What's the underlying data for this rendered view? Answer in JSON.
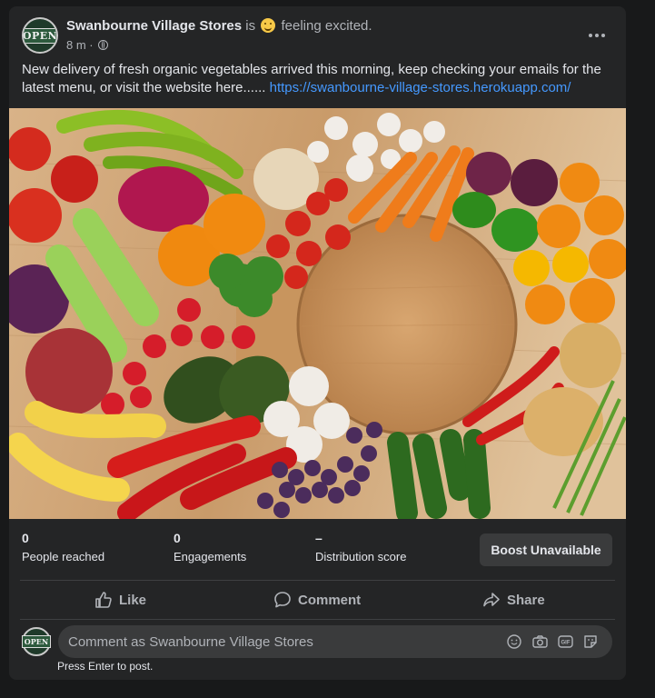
{
  "post": {
    "page_name": "Swanbourne Village Stores",
    "is_text": "is",
    "feeling_text": "feeling excited.",
    "time": "8 m",
    "time_sep": "·",
    "avatar_text": "OPEN",
    "body_text": "New delivery of fresh organic vegetables arrived this morning, keep checking your emails for the latest menu, or visit the website here...... ",
    "link_text": "https://swanbourne-village-stores.herokuapp.com/",
    "image_subject": "fresh vegetables and fruit arranged around a round wooden board"
  },
  "stats": [
    {
      "value": "0",
      "label": "People reached"
    },
    {
      "value": "0",
      "label": "Engagements"
    },
    {
      "value": "–",
      "label": "Distribution score"
    }
  ],
  "boost_label": "Boost Unavailable",
  "actions": {
    "like": "Like",
    "comment": "Comment",
    "share": "Share"
  },
  "comment_box": {
    "placeholder": "Comment as Swanbourne Village Stores",
    "hint": "Press Enter to post.",
    "icons": [
      "emoji-icon",
      "camera-icon",
      "gif-icon",
      "sticker-icon"
    ]
  },
  "colors": {
    "background": "#18191a",
    "card": "#242526",
    "link": "#4599ff",
    "button": "#3a3b3c"
  }
}
